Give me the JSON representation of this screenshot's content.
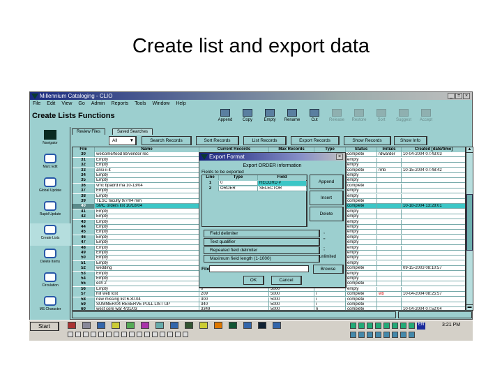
{
  "slide": {
    "title": "Create list and export data"
  },
  "window": {
    "title": "Millennium Cataloging - CLIO",
    "min": "_",
    "max": "=",
    "close": "×"
  },
  "menu": [
    "File",
    "Edit",
    "View",
    "Go",
    "Admin",
    "Reports",
    "Tools",
    "Window",
    "Help"
  ],
  "header": "Create Lists Functions",
  "toolbar": [
    {
      "label": "Append",
      "enabled": true
    },
    {
      "label": "Copy",
      "enabled": true
    },
    {
      "label": "Empty",
      "enabled": true
    },
    {
      "label": "Rename",
      "enabled": true
    },
    {
      "label": "Cut",
      "enabled": true
    },
    {
      "label": "Release",
      "enabled": false
    },
    {
      "label": "Restore",
      "enabled": false
    },
    {
      "label": "Sort",
      "enabled": false
    },
    {
      "label": "Suggest",
      "enabled": false
    },
    {
      "label": "Accept",
      "enabled": false
    }
  ],
  "sidebar": [
    "Navigator",
    "Marc Edit",
    "Global Update",
    "Rapid Update",
    "Create Lists",
    "Delete Items",
    "Circulation",
    "MS Character"
  ],
  "tabs": [
    "Review Files",
    "Saved Searches"
  ],
  "filter": "All",
  "actions": [
    "Search Records",
    "Sort Records",
    "List Records",
    "Export Records",
    "Show Records",
    "Show Info"
  ],
  "columns": [
    "File",
    "Name",
    "Current Records",
    "Max Records",
    "Type",
    "Status",
    "Initials",
    "Created [date/time]"
  ],
  "rows": [
    [
      "30",
      "welcome/food lib/vendor rec",
      "",
      "",
      "",
      "complete",
      "rdwarder",
      "10-04-2004 07:43:03"
    ],
    [
      "31",
      "Empty",
      "",
      "",
      "",
      "empty",
      "",
      ""
    ],
    [
      "32",
      "Empty",
      "",
      "",
      "",
      "empty",
      "",
      ""
    ],
    [
      "33",
      "ansi-ii-it",
      "",
      "",
      "",
      "complete",
      "rmb",
      "10-15-2004 07:48:42"
    ],
    [
      "34",
      "Empty",
      "",
      "",
      "",
      "empty",
      "",
      ""
    ],
    [
      "35",
      "Empty",
      "",
      "",
      "",
      "empty",
      "",
      ""
    ],
    [
      "36",
      "vmc bpadrd ma 10-13/04",
      "",
      "",
      "",
      "complete",
      "",
      ""
    ],
    [
      "37",
      "Empty",
      "",
      "",
      "",
      "empty",
      "",
      ""
    ],
    [
      "38",
      "Empty",
      "",
      "",
      "",
      "empty",
      "",
      ""
    ],
    [
      "39",
      "TESC faculty 9/7/04 mm",
      "",
      "",
      "",
      "complete",
      "",
      ""
    ],
    [
      "40",
      "SMC orders list 10/18/04",
      "",
      "",
      "",
      "complete",
      "",
      "10-18-2004 13:28:01"
    ],
    [
      "41",
      "Empty",
      "",
      "",
      "",
      "empty",
      "",
      ""
    ],
    [
      "42",
      "Empty",
      "",
      "",
      "",
      "empty",
      "",
      ""
    ],
    [
      "43",
      "Empty",
      "",
      "",
      "",
      "empty",
      "",
      ""
    ],
    [
      "44",
      "Empty",
      "",
      "",
      "",
      "empty",
      "",
      ""
    ],
    [
      "45",
      "Empty",
      "",
      "",
      "",
      "empty",
      "",
      ""
    ],
    [
      "46",
      "Empty",
      "",
      "",
      "",
      "empty",
      "",
      ""
    ],
    [
      "47",
      "Empty",
      "",
      "",
      "",
      "empty",
      "",
      ""
    ],
    [
      "48",
      "Empty",
      "",
      "",
      "",
      "empty",
      "",
      ""
    ],
    [
      "49",
      "Empty",
      "",
      "",
      "",
      "empty",
      "",
      ""
    ],
    [
      "50",
      "Empty",
      "",
      "",
      "",
      "empty",
      "",
      ""
    ],
    [
      "51",
      "Empty",
      "",
      "",
      "",
      "empty",
      "",
      ""
    ],
    [
      "52",
      "wedding",
      "",
      "",
      "",
      "complete",
      "",
      "09-15-2003 08:10:57"
    ],
    [
      "53",
      "Empty",
      "",
      "",
      "",
      "empty",
      "",
      ""
    ],
    [
      "54",
      "Empty",
      "",
      "",
      "",
      "empty",
      "",
      ""
    ],
    [
      "55",
      "ech 2",
      "",
      "",
      "",
      "complete",
      "",
      ""
    ],
    [
      "56",
      "Empty",
      "0",
      "5000",
      "",
      "empty",
      "",
      ""
    ],
    [
      "57",
      "hill web lost",
      "209",
      "5000",
      "i",
      "complete",
      "wb",
      "10-04-2004 08:25:57"
    ],
    [
      "58",
      "new missing list 6.30.04",
      "300",
      "5000",
      "i",
      "complete",
      "",
      ""
    ],
    [
      "59",
      "SUMMER/04 RESERVE PULL LIST UP",
      "340",
      "5000",
      "i",
      "complete",
      "",
      ""
    ],
    [
      "60",
      "west core war 4/31/03",
      "3349",
      "5000",
      "n",
      "complete",
      "",
      "10-04-2004 07:52:04"
    ]
  ],
  "selected_row": "40",
  "dialog": {
    "title": "Export Format",
    "close": "×",
    "heading": "Export ORDER information",
    "fields_label": "Fields to be exported",
    "columns": [
      "Line",
      "Type",
      "Field"
    ],
    "fields": [
      [
        "1",
        "0",
        "RECORD #"
      ],
      [
        "2",
        "ORDER",
        "SELECTOR"
      ]
    ],
    "buttons": [
      "Append",
      "Insert",
      "Delete"
    ],
    "settings": [
      {
        "label": "Field delimiter",
        "value": ","
      },
      {
        "label": "Text qualifier",
        "value": "\""
      },
      {
        "label": "Repeated field delimiter",
        "value": ";"
      },
      {
        "label": "Maximum field length (1-1000)",
        "value": "unlimited"
      }
    ],
    "file_label": "File",
    "file_value": "",
    "browse": "Browse",
    "ok": "OK",
    "cancel": "Cancel"
  },
  "taskbar": {
    "start": "Start",
    "lang": "EN",
    "clock": "3:21 PM"
  }
}
